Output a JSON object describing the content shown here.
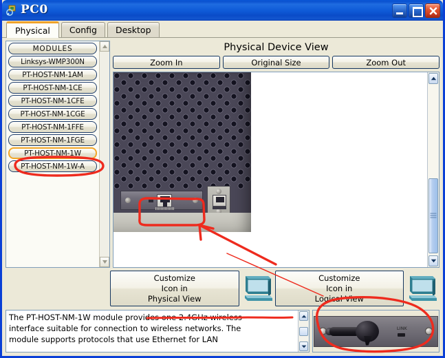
{
  "window": {
    "title": "PC0",
    "icon": "packet-tracer-icon",
    "buttons": {
      "minimize": "Minimize",
      "maximize": "Maximize",
      "close": "Close"
    },
    "accent": "#0a3fd6",
    "titlebar_color": "#0f5bd8"
  },
  "tabs": [
    {
      "label": "Physical",
      "active": true
    },
    {
      "label": "Config",
      "active": false
    },
    {
      "label": "Desktop",
      "active": false
    }
  ],
  "modules": {
    "header": "MODULES",
    "selected": "PT-HOST-NM-1W",
    "selection_color": "#f2a626",
    "items": [
      {
        "label": "Linksys-WMP300N"
      },
      {
        "label": "PT-HOST-NM-1AM"
      },
      {
        "label": "PT-HOST-NM-1CE"
      },
      {
        "label": "PT-HOST-NM-1CFE"
      },
      {
        "label": "PT-HOST-NM-1CGE"
      },
      {
        "label": "PT-HOST-NM-1FFE"
      },
      {
        "label": "PT-HOST-NM-1FGE"
      },
      {
        "label": "PT-HOST-NM-1W"
      },
      {
        "label": "PT-HOST-NM-1W-A"
      }
    ]
  },
  "device_view": {
    "title": "Physical Device View",
    "zoom_in": "Zoom In",
    "original_size": "Original Size",
    "zoom_out": "Zoom Out",
    "chassis_color": "#4a4757",
    "base_color": "#cdccc4"
  },
  "customize": {
    "physical": {
      "line1": "Customize",
      "line2": "Icon in",
      "line3": "Physical View",
      "icon": "computer-icon"
    },
    "logical": {
      "line1": "Customize",
      "line2": "Icon in",
      "line3": "Logical View",
      "icon": "computer-icon"
    }
  },
  "description": {
    "line1": "The PT-HOST-NM-1W module provides one 2.4GHz wireless",
    "line2": "interface suitable for connection to wireless networks. The",
    "line3": "module supports protocols that use Ethernet for LAN"
  },
  "module_preview": {
    "name": "PT-HOST-NM-1W",
    "led_label": "LINK",
    "faceplate_color": "#76737b"
  },
  "annotations": {
    "color": "#ee2b1e",
    "marks": [
      "ellipse-around-selected-module",
      "rectangle-around-module-slot",
      "arrow-pointing-to-slot",
      "underline-under-description",
      "ellipse-around-module-preview",
      "connector-line"
    ]
  }
}
